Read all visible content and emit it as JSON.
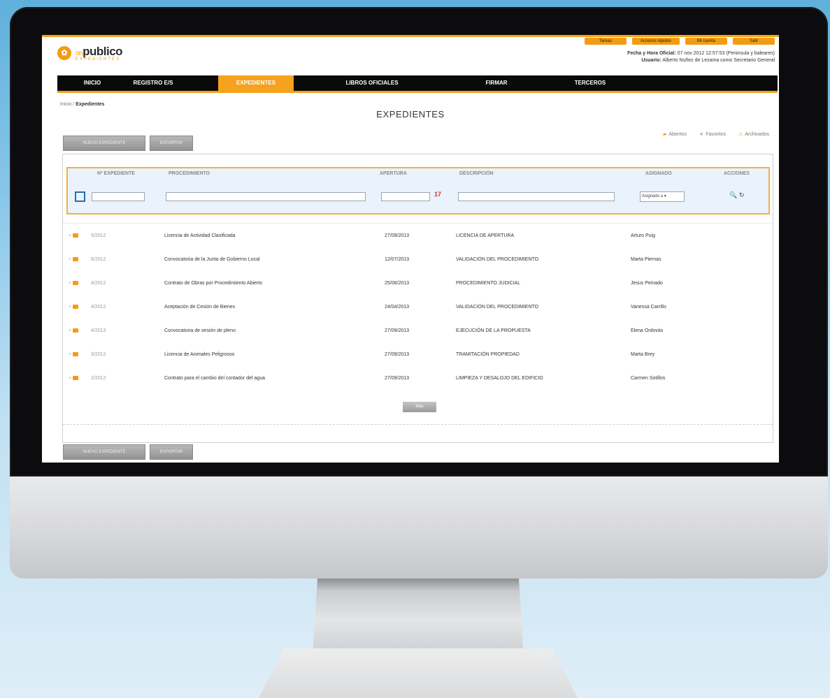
{
  "app": {
    "logo_main": "publico",
    "logo_prefix": "on",
    "logo_sub": "EXPEDIENTES",
    "top_links": [
      "Tareas",
      "Accesos rápidos",
      "Mi cuenta",
      "Salir"
    ],
    "date_label": "Fecha y Hora Oficial:",
    "date_value": "07 nov 2012 12:57:53 (Peninsula y baleares)",
    "user_label": "Usuario:",
    "user_value": "Alberto Nuñez de Lezama como Secretario General"
  },
  "nav": {
    "items": [
      "INICIO",
      "REGISTRO E/S",
      "EXPEDIENTES",
      "LIBROS OFICIALES",
      "FIRMAR",
      "TERCEROS"
    ],
    "active": "EXPEDIENTES"
  },
  "breadcrumb": {
    "home": "Inicio",
    "separator": "/",
    "current": "Expedientes"
  },
  "page": {
    "title": "EXPEDIENTES"
  },
  "buttons": {
    "new_expediente": "NUEVO EXPEDIENTE",
    "export": "EXPORTAR",
    "more": "Más"
  },
  "legend": {
    "open": "Abiertos",
    "favorites": "Favoritos",
    "archived": "Archivados"
  },
  "filter": {
    "headers": [
      "Nº EXPEDIENTE",
      "PROCEDIMIENTO",
      "APERTURA",
      "DESCRIPCIÓN",
      "ASIGNADO",
      "ACCIONES"
    ],
    "assigned_value": "Asignado a"
  },
  "rows": [
    {
      "num": "5/2012",
      "procedimiento": "Licencia de Actividad Clasificada",
      "apertura": "27/09/2013",
      "descripcion": "LICENCIA DE APERTURA",
      "asignado": "Arturo Puig"
    },
    {
      "num": "6/2012",
      "procedimiento": "Convocatoria de la Junta de Gobierno Local",
      "apertura": "12/07/2013",
      "descripcion": "VALIDACIÓN DEL PROCEDIMIENTO",
      "asignado": "Marta Piernas"
    },
    {
      "num": "4/2012",
      "procedimiento": "Contrato de Obras por Procedimiento Abierto",
      "apertura": "25/06/2013",
      "descripcion": "PROCEDIMIENTO JUDICIAL",
      "asignado": "Jesus Peinado"
    },
    {
      "num": "4/2012",
      "procedimiento": "Aceptación de Cesión de Bienes",
      "apertura": "24/04/2013",
      "descripcion": "VALIDACIÓN DEL PROCEDIMIENTO",
      "asignado": "Vanessa Carrillo"
    },
    {
      "num": "4/2013",
      "procedimiento": "Convocatoria de sesión de pleno",
      "apertura": "27/09/2013",
      "descripcion": "EJECUCIÓN DE LA PROPUESTA",
      "asignado": "Elena Ordovás"
    },
    {
      "num": "3/2012",
      "procedimiento": "Licencia de Animales Peligrosos",
      "apertura": "27/09/2013",
      "descripcion": "TRAMITACIÓN PROPIEDAD",
      "asignado": "Marta Brey"
    },
    {
      "num": "2/2012",
      "procedimiento": "Contrato para el cambio del contador del agua",
      "apertura": "27/09/2013",
      "descripcion": "LIMPIEZA Y DESALOJO DEL EDIFICIO",
      "asignado": "Carmen Sotillos"
    }
  ],
  "colors": {
    "accent": "#f5a21d",
    "navbar": "#0a0a0a",
    "filter_bg": "#eaf3fb"
  }
}
